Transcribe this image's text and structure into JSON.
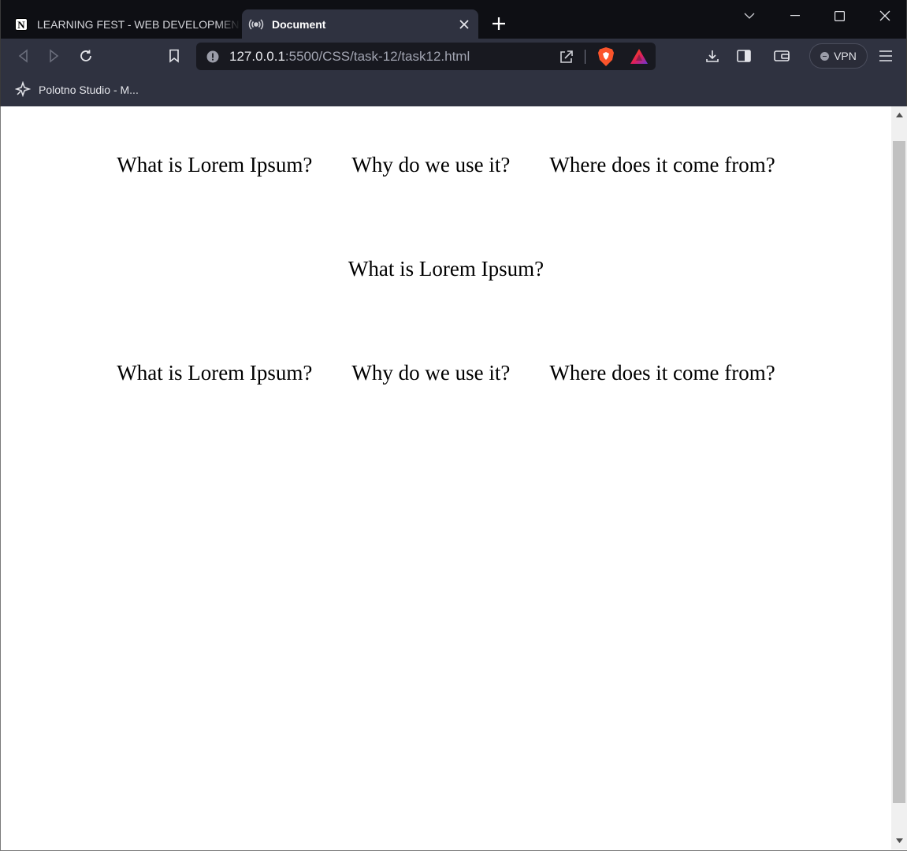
{
  "tabs": [
    {
      "title": "LEARNING FEST - WEB DEVELOPMENT",
      "favicon": "notion-icon",
      "active": false
    },
    {
      "title": "Document",
      "favicon": "live-server-icon",
      "active": true
    }
  ],
  "address_bar": {
    "host": "127.0.0.1",
    "path": ":5500/CSS/task-12/task12.html"
  },
  "vpn_label": "VPN",
  "bookmarks": [
    {
      "label": "Polotno Studio - M...",
      "icon": "polotno-icon"
    }
  ],
  "page": {
    "row1": [
      "What is Lorem Ipsum?",
      "Why do we use it?",
      "Where does it come from?"
    ],
    "row2": [
      "What is Lorem Ipsum?"
    ],
    "row3": [
      "What is Lorem Ipsum?",
      "Why do we use it?",
      "Where does it come from?"
    ]
  },
  "colors": {
    "titlebar_bg": "#0e0f14",
    "toolbar_bg": "#2f3240",
    "urlbar_bg": "#181920",
    "brave_orange": "#fb542b"
  }
}
